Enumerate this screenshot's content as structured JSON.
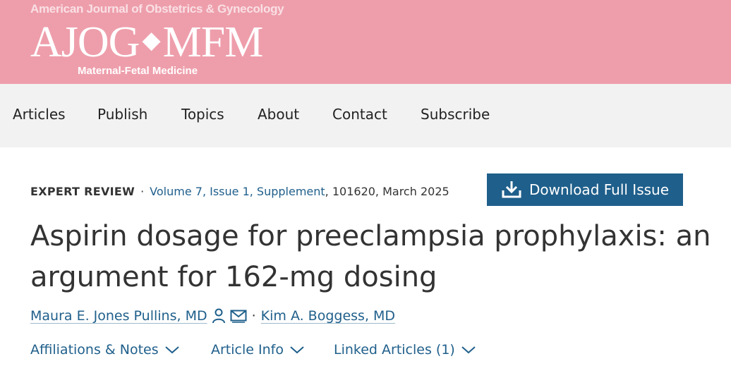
{
  "header": {
    "journal_name": "American Journal of Obstetrics & Gynecology",
    "logo_left": "AJOG",
    "logo_separator": "◆",
    "logo_right": "MFM",
    "logo_subtitle": "Maternal-Fetal Medicine"
  },
  "nav": {
    "items": [
      {
        "label": "Articles"
      },
      {
        "label": "Publish"
      },
      {
        "label": "Topics"
      },
      {
        "label": "About"
      },
      {
        "label": "Contact"
      },
      {
        "label": "Subscribe"
      }
    ]
  },
  "article": {
    "type": "EXPERT REVIEW",
    "separator": "·",
    "volume": "Volume 7, Issue 1, Supplement",
    "citation": ", 101620, March 2025",
    "download_label": "Download Full Issue",
    "title": "Aspirin dosage for preeclampsia prophylaxis: an argument for 162-mg dosing",
    "authors": [
      {
        "name": "Maura E. Jones Pullins, MD"
      },
      {
        "name": "Kim A. Boggess, MD"
      }
    ],
    "author_separator": "·",
    "tabs": [
      {
        "label": "Affiliations & Notes"
      },
      {
        "label": "Article Info"
      },
      {
        "label": "Linked Articles (1)"
      }
    ]
  },
  "colors": {
    "header_bg": "#ee9eab",
    "nav_bg": "#f2f2f2",
    "accent": "#1f5f8b"
  },
  "icons": {
    "download": "download-icon",
    "person": "person-icon",
    "envelope": "envelope-icon",
    "chevron": "chevron-down-icon"
  }
}
